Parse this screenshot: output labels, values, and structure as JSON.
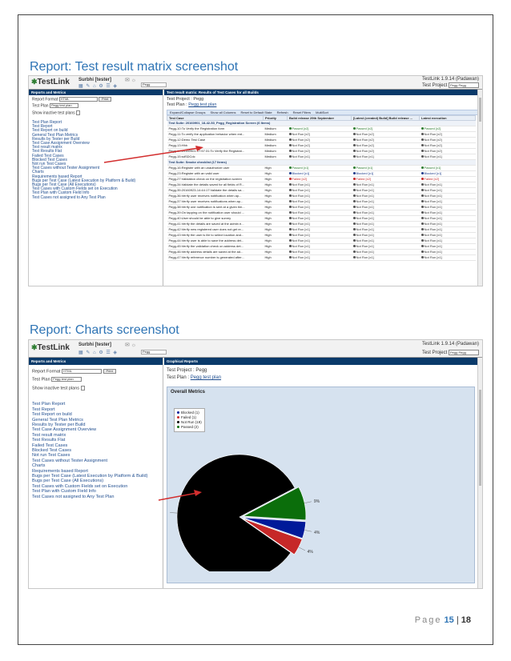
{
  "sections": {
    "matrix_title": "Report: Test result matrix screenshot",
    "charts_title": "Report: Charts screenshot"
  },
  "app": {
    "logo_text": "TestLink",
    "user": "Surbhi [tester]",
    "version": "TestLink 1.9.14 (Padawan)",
    "project_label": "Test Project",
    "project_value": "Pegg Pegg",
    "search_value": "Pegg"
  },
  "left_pane": {
    "header": "Reports and Metrics",
    "report_format_label": "Report Format",
    "report_format_value": "HTML",
    "print_button": "Print",
    "test_plan_label": "Test Plan",
    "test_plan_value": "Pegg test plan",
    "show_inactive_label": "Show inactive test plans",
    "menu": [
      "Test Plan Report",
      "Test Report",
      "Test Report on build",
      "General Test Plan Metrics",
      "Results by Tester per Build",
      "Test Case Assignment Overview",
      "Test result matrix",
      "Test Results Flat",
      "Failed Test Cases",
      "Blocked Test Cases",
      "Not run Test Cases",
      "Test Cases without Tester Assignment",
      "Charts",
      "Requirements based Report",
      "Bugs per Test Case (Latest Execution by Platform & Build)",
      "Bugs per Test Case (All Executions)",
      "Test Cases with Custom Fields set on Execution",
      "Test Plan with Custom Field Info",
      "Test Cases not assigned to Any Test Plan"
    ]
  },
  "matrix": {
    "header": "Test result matrix: Results of Test Cases for all Builds",
    "project_label": "Test Project :",
    "project_value": "Pegg",
    "plan_label": "Test Plan :",
    "plan_value": "Pegg test plan",
    "toolbar": [
      "Expand/Collapse Groups",
      "Show all Columns",
      "Reset to Default State",
      "Refresh",
      "Reset Filters",
      "MultiSort"
    ],
    "columns": [
      "Test Case",
      "Priority",
      "Build release 29th September",
      "[Latest (created) Build] Build release ...",
      "Latest execution"
    ],
    "groups": [
      {
        "label": "Test Suite: 20160901_18-42-53_Pegg_Registration Screen (6 Items)",
        "rows": [
          {
            "tc": "Pegg-10:To Verify the Registration form",
            "priority": "Medium",
            "b1": "Passed [x2]",
            "b1s": "pass",
            "b2": "Passed [x2]",
            "b2s": "pass",
            "b3": "Passed [x2]",
            "b3s": "pass"
          },
          {
            "tc": "Pegg-11:To verify the application behavior when ent...",
            "priority": "Medium",
            "b1": "Not Run [x2]",
            "b1s": "notrun",
            "b2": "Not Run [x2]",
            "b2s": "notrun",
            "b3": "Not Run [x2]",
            "b3s": "notrun"
          },
          {
            "tc": "Pegg-12:Demo Test Case",
            "priority": "Medium",
            "b1": "Not Run [x2]",
            "b1s": "notrun",
            "b2": "Not Run [x2]",
            "b2s": "notrun",
            "b3": "Not Run [x2]",
            "b3s": "notrun"
          },
          {
            "tc": "Pegg-13:Hhh",
            "priority": "Medium",
            "b1": "Not Run [x2]",
            "b1s": "notrun",
            "b2": "Not Run [x2]",
            "b2s": "notrun",
            "b3": "Not Run [x2]",
            "b3s": "notrun"
          },
          {
            "tc": "Pegg-14:20160901-17:57:31:To Verify the Registrat...",
            "priority": "Medium",
            "b1": "Not Run [x2]",
            "b1s": "notrun",
            "b2": "Not Run [x2]",
            "b2s": "notrun",
            "b3": "Not Run [x2]",
            "b3s": "notrun"
          },
          {
            "tc": "Pegg-15:sdSDCdc",
            "priority": "Medium",
            "b1": "Not Run [x1]",
            "b1s": "notrun",
            "b2": "Not Run [x1]",
            "b2s": "notrun",
            "b3": "Not Run [x1]",
            "b3s": "notrun"
          }
        ]
      },
      {
        "label": "Test Suite: Smoke checklist (17 Items)",
        "rows": [
          {
            "tc": "Pegg-16:Register with an unauthorize user",
            "priority": "High",
            "b1": "Passed [x1]",
            "b1s": "pass",
            "b2": "Passed [x1]",
            "b2s": "pass",
            "b3": "Passed [x1]",
            "b3s": "pass"
          },
          {
            "tc": "Pegg-23:Register with an valid user",
            "priority": "High",
            "b1": "Blocked [x1]",
            "b1s": "blocked",
            "b2": "Blocked [x1]",
            "b2s": "blocked",
            "b3": "Blocked [x1]",
            "b3s": "blocked"
          },
          {
            "tc": "Pegg-27:Validation check on the registration screen",
            "priority": "High",
            "b1": "Failed [x2]",
            "b1s": "failed",
            "b2": "Failed [x2]",
            "b2s": "failed",
            "b3": "Failed [x2]",
            "b3s": "failed"
          },
          {
            "tc": "Pegg-34:Validate the details saved for all fields of R...",
            "priority": "High",
            "b1": "Not Run [x1]",
            "b1s": "notrun",
            "b2": "Not Run [x1]",
            "b2s": "notrun",
            "b3": "Not Run [x1]",
            "b3s": "notrun"
          },
          {
            "tc": "Pegg-35:20160923-14:44:17:Validate the details sa...",
            "priority": "High",
            "b1": "Not Run [x1]",
            "b1s": "notrun",
            "b2": "Not Run [x1]",
            "b2s": "notrun",
            "b3": "Not Run [x1]",
            "b3s": "notrun"
          },
          {
            "tc": "Pegg-36:Verify user receives notification when ap...",
            "priority": "High",
            "b1": "Not Run [x1]",
            "b1s": "notrun",
            "b2": "Not Run [x1]",
            "b2s": "notrun",
            "b3": "Not Run [x1]",
            "b3s": "notrun"
          },
          {
            "tc": "Pegg-37:Verify user receives notifications when ap...",
            "priority": "High",
            "b1": "Not Run [x1]",
            "b1s": "notrun",
            "b2": "Not Run [x1]",
            "b2s": "notrun",
            "b3": "Not Run [x1]",
            "b3s": "notrun"
          },
          {
            "tc": "Pegg-38:Verify one notification is sent at a given tim...",
            "priority": "High",
            "b1": "Not Run [x1]",
            "b1s": "notrun",
            "b2": "Not Run [x1]",
            "b2s": "notrun",
            "b3": "Not Run [x1]",
            "b3s": "notrun"
          },
          {
            "tc": "Pegg-39:On tapping on the notification user should ...",
            "priority": "High",
            "b1": "Not Run [x1]",
            "b1s": "notrun",
            "b2": "Not Run [x1]",
            "b2s": "notrun",
            "b3": "Not Run [x1]",
            "b3s": "notrun"
          },
          {
            "tc": "Pegg-40:User should be able to give survey",
            "priority": "High",
            "b1": "Not Run [x1]",
            "b1s": "notrun",
            "b2": "Not Run [x1]",
            "b2s": "notrun",
            "b3": "Not Run [x1]",
            "b3s": "notrun"
          },
          {
            "tc": "Pegg-41:Verify the details are saved at the admin e...",
            "priority": "High",
            "b1": "Not Run [x1]",
            "b1s": "notrun",
            "b2": "Not Run [x1]",
            "b2s": "notrun",
            "b3": "Not Run [x1]",
            "b3s": "notrun"
          },
          {
            "tc": "Pegg-42:Verify new registered user does not get re...",
            "priority": "High",
            "b1": "Not Run [x1]",
            "b1s": "notrun",
            "b2": "Not Run [x1]",
            "b2s": "notrun",
            "b3": "Not Run [x1]",
            "b3s": "notrun"
          },
          {
            "tc": "Pegg-43:Verify the user is lile to select location and...",
            "priority": "High",
            "b1": "Not Run [x1]",
            "b1s": "notrun",
            "b2": "Not Run [x1]",
            "b2s": "notrun",
            "b3": "Not Run [x1]",
            "b3s": "notrun"
          },
          {
            "tc": "Pegg-44:Verify user is able to save the address det...",
            "priority": "High",
            "b1": "Not Run [x1]",
            "b1s": "notrun",
            "b2": "Not Run [x1]",
            "b2s": "notrun",
            "b3": "Not Run [x1]",
            "b3s": "notrun"
          },
          {
            "tc": "Pegg-45:Verify the validation check on address det...",
            "priority": "High",
            "b1": "Not Run [x1]",
            "b1s": "notrun",
            "b2": "Not Run [x1]",
            "b2s": "notrun",
            "b3": "Not Run [x1]",
            "b3s": "notrun"
          },
          {
            "tc": "Pegg-46:Verify address details are saved at the ad...",
            "priority": "High",
            "b1": "Not Run [x1]",
            "b1s": "notrun",
            "b2": "Not Run [x1]",
            "b2s": "notrun",
            "b3": "Not Run [x1]",
            "b3s": "notrun"
          },
          {
            "tc": "Pegg-47:Verify reference number is generated after...",
            "priority": "High",
            "b1": "Not Run [x1]",
            "b1s": "notrun",
            "b2": "Not Run [x1]",
            "b2s": "notrun",
            "b3": "Not Run [x1]",
            "b3s": "notrun"
          }
        ]
      }
    ]
  },
  "charts": {
    "header": "Graphical Reports",
    "project_label": "Test Project :",
    "project_value": "Pegg",
    "plan_label": "Test Plan :",
    "plan_value": "Pegg test plan",
    "panel_title": "Overall Metrics",
    "chart_data": {
      "type": "pie",
      "title": "Overall Metrics",
      "legend_placement": "top-left",
      "slices": [
        {
          "label": "Blocked (1)",
          "value": 1,
          "pct_label": "4%",
          "color": "#001a99"
        },
        {
          "label": "Failed (1)",
          "value": 1,
          "pct_label": "4%",
          "color": "#c62828"
        },
        {
          "label": "Not Run (19)",
          "value": 19,
          "pct_label": "83%",
          "color": "#000000"
        },
        {
          "label": "Passed (2)",
          "value": 2,
          "pct_label": "9%",
          "color": "#0b6e0b"
        }
      ]
    }
  },
  "footer": {
    "page_word": "Page",
    "page_number": "15",
    "separator": "|",
    "total_pages": "18"
  },
  "colors": {
    "accent": "#2e74b5",
    "pane_header": "#0a3a6a",
    "arrow": "#d32f2f"
  }
}
